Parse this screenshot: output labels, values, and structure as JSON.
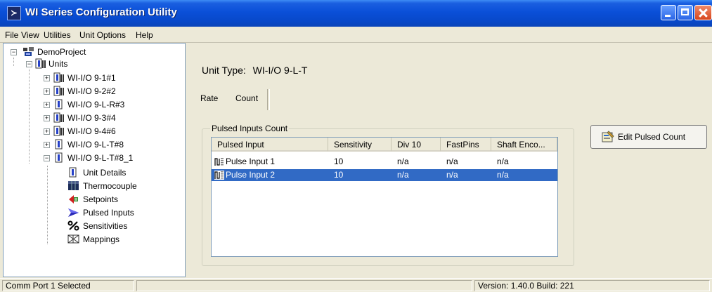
{
  "window": {
    "title": "WI Series Configuration Utility"
  },
  "menu": [
    "File",
    "View",
    "Utilities",
    "Unit Options",
    "Help"
  ],
  "tree": {
    "root": "DemoProject",
    "units_label": "Units",
    "units": [
      "WI-I/O 9-1#1",
      "WI-I/O 9-2#2",
      "WI-I/O 9-L-R#3",
      "WI-I/O 9-3#4",
      "WI-I/O 9-4#6",
      "WI-I/O 9-L-T#8",
      "WI-I/O 9-L-T#8_1"
    ],
    "children": [
      "Unit Details",
      "Thermocouple",
      "Setpoints",
      "Pulsed Inputs",
      "Sensitivities",
      "Mappings"
    ]
  },
  "main": {
    "unit_type_label": "Unit Type:",
    "unit_type_value": "WI-I/O 9-L-T",
    "tabs": [
      "Rate",
      "Count"
    ],
    "group_label": "Pulsed Inputs Count",
    "columns": [
      "Pulsed Input",
      "Sensitivity",
      "Div 10",
      "FastPins",
      "Shaft Enco..."
    ],
    "rows": [
      [
        "Pulse Input 1",
        "10",
        "n/a",
        "n/a",
        "n/a"
      ],
      [
        "Pulse Input 2",
        "10",
        "n/a",
        "n/a",
        "n/a"
      ]
    ],
    "edit_button": "Edit Pulsed Count"
  },
  "status": {
    "left": "Comm Port 1 Selected",
    "middle": "",
    "version": "Version: 1.40.0 Build: 221"
  }
}
